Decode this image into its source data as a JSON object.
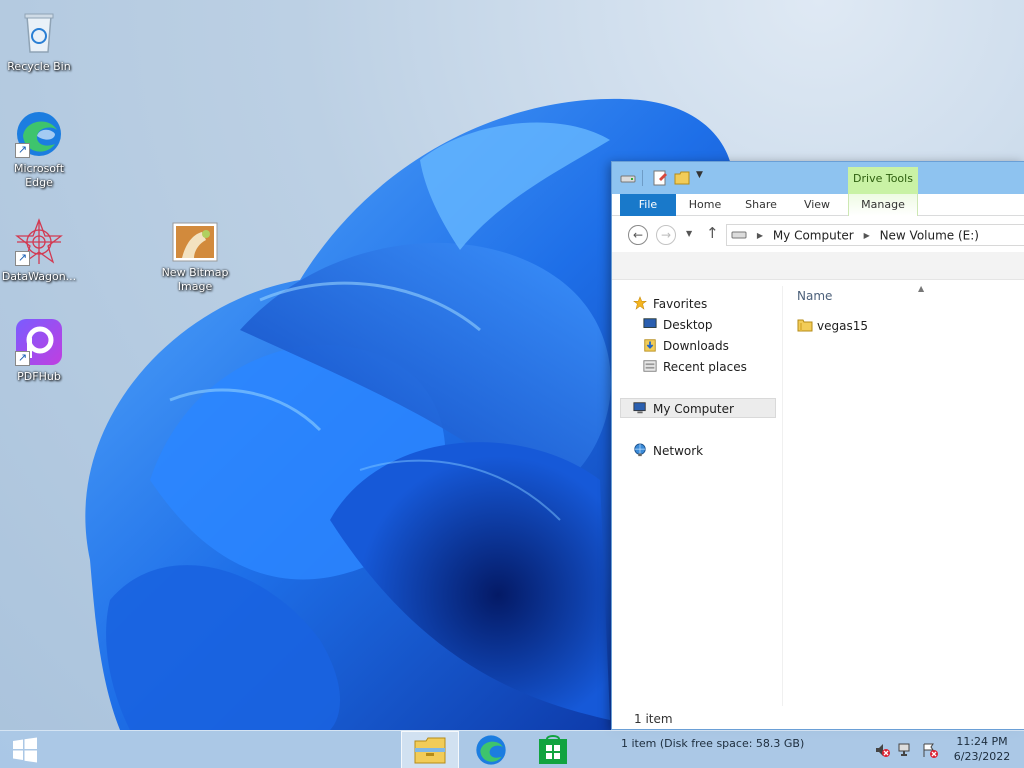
{
  "desktop": {
    "icons": [
      {
        "label": "Recycle Bin"
      },
      {
        "label": "Microsoft Edge"
      },
      {
        "label": "DataWagon..."
      },
      {
        "label": "New Bitmap Image"
      },
      {
        "label": "PDFHub"
      }
    ]
  },
  "explorer": {
    "context_tab": "Drive Tools",
    "tabs": {
      "file": "File",
      "home": "Home",
      "share": "Share",
      "view": "View",
      "manage": "Manage"
    },
    "address": {
      "crumb1": "My Computer",
      "crumb2": "New Volume (E:)"
    },
    "nav": {
      "favorites": "Favorites",
      "desktop": "Desktop",
      "downloads": "Downloads",
      "recent": "Recent places",
      "my_computer": "My Computer",
      "network": "Network"
    },
    "content": {
      "column_name": "Name",
      "files": [
        {
          "name": "vegas15"
        }
      ]
    },
    "item_count": "1 item"
  },
  "taskbar": {
    "status": "1 item (Disk free space: 58.3 GB)",
    "time": "11:24 PM",
    "date": "6/23/2022"
  },
  "colors": {
    "accent": "#1979ca",
    "context_tab": "#c9f2a5",
    "titlebar": "#8ec3f0"
  }
}
